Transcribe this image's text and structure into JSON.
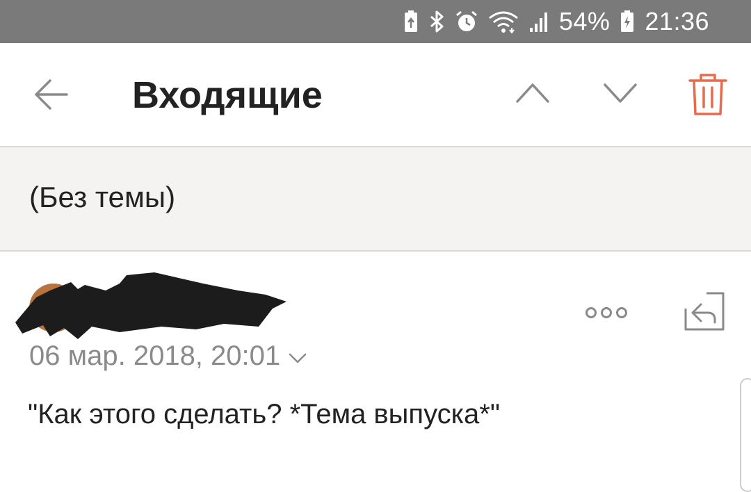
{
  "status_bar": {
    "battery_percent": "54%",
    "time": "21:36",
    "icons": [
      "battery-saver-icon",
      "bluetooth-icon",
      "alarm-icon",
      "wifi-icon",
      "signal-icon",
      "battery-charging-icon"
    ],
    "background": "#7a7a7a"
  },
  "toolbar": {
    "title": "Входящие",
    "back_icon": "arrow-left-icon",
    "prev_icon": "chevron-up-icon",
    "next_icon": "chevron-down-icon",
    "delete_icon": "trash-icon",
    "delete_color": "#e86a4c"
  },
  "subject": {
    "text": "(Без темы)"
  },
  "message": {
    "date": "06 мар. 2018, 20:01",
    "body": "\"Как этого сделать? *Тема выпуска*\"",
    "more_icon": "more-dots-icon",
    "reply_icon": "reply-icon",
    "expand_icon": "chevron-down-small-icon"
  }
}
